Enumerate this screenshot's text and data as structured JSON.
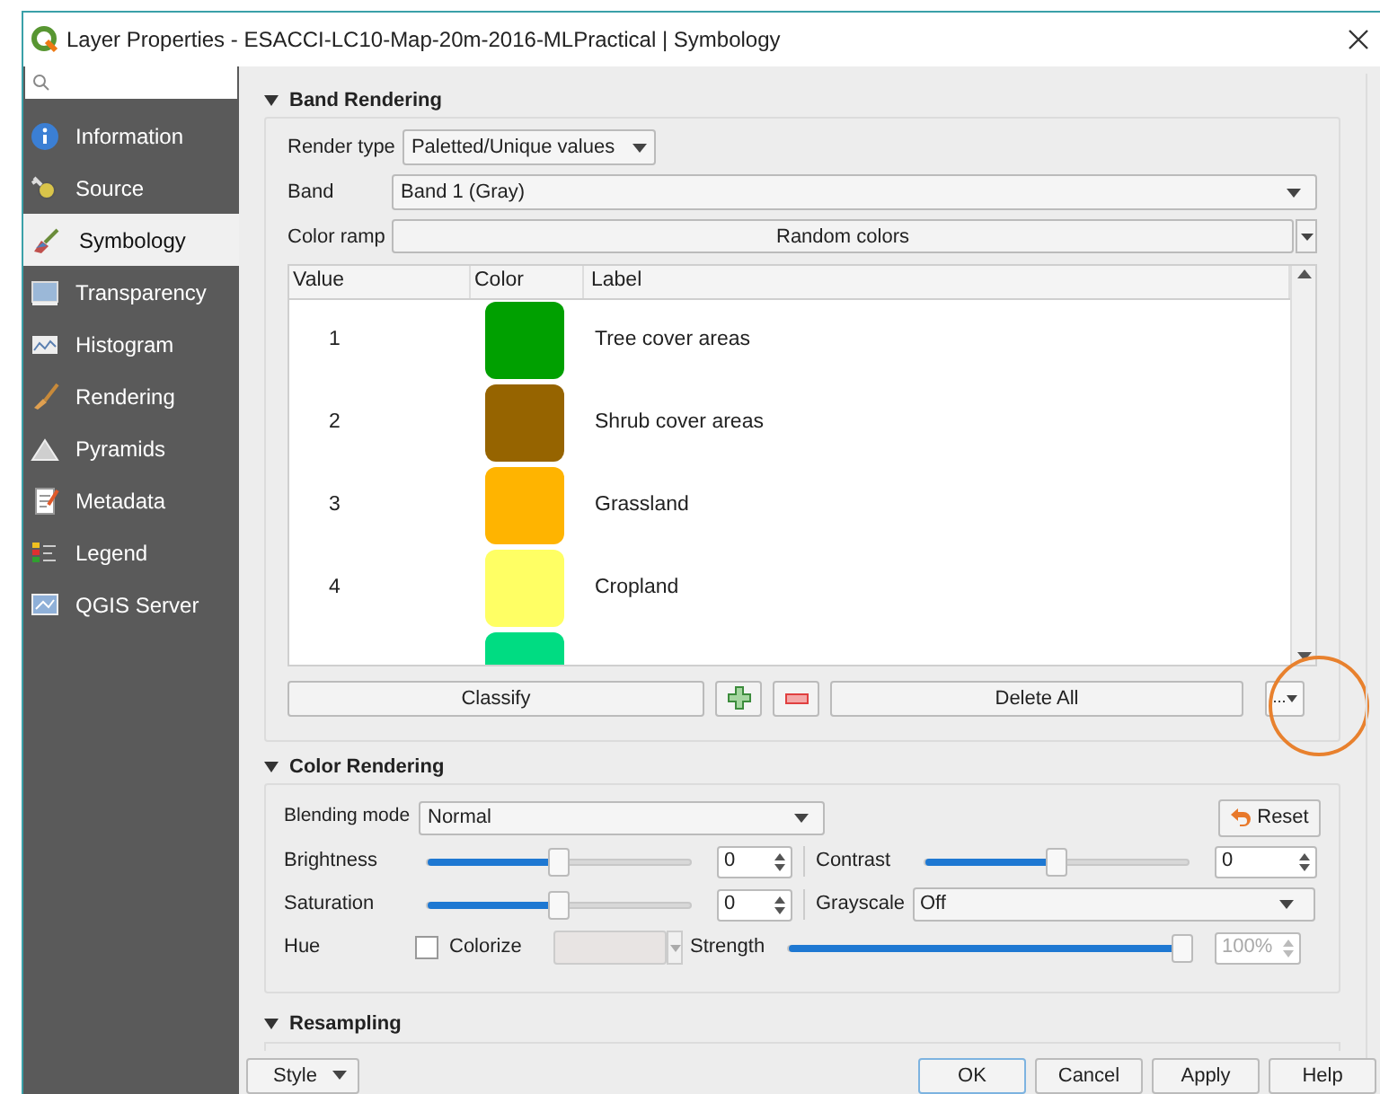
{
  "window": {
    "title": "Layer Properties - ESACCI-LC10-Map-20m-2016-MLPractical | Symbology"
  },
  "sidebar": {
    "items": [
      {
        "label": "Information",
        "selected": false
      },
      {
        "label": "Source",
        "selected": false
      },
      {
        "label": "Symbology",
        "selected": true
      },
      {
        "label": "Transparency",
        "selected": false
      },
      {
        "label": "Histogram",
        "selected": false
      },
      {
        "label": "Rendering",
        "selected": false
      },
      {
        "label": "Pyramids",
        "selected": false
      },
      {
        "label": "Metadata",
        "selected": false
      },
      {
        "label": "Legend",
        "selected": false
      },
      {
        "label": "QGIS Server",
        "selected": false
      }
    ]
  },
  "band_rendering": {
    "title": "Band Rendering",
    "render_type_label": "Render type",
    "render_type": "Paletted/Unique values",
    "band_label": "Band",
    "band": "Band 1 (Gray)",
    "color_ramp_label": "Color ramp",
    "color_ramp": "Random colors",
    "table": {
      "columns": [
        "Value",
        "Color",
        "Label"
      ],
      "rows": [
        {
          "value": "1",
          "color": "#00a000",
          "label": "Tree cover areas"
        },
        {
          "value": "2",
          "color": "#966400",
          "label": "Shrub cover areas"
        },
        {
          "value": "3",
          "color": "#ffb400",
          "label": "Grassland"
        },
        {
          "value": "4",
          "color": "#ffff64",
          "label": "Cropland"
        },
        {
          "color": "#00dc82"
        }
      ]
    },
    "classify": "Classify",
    "delete_all": "Delete All",
    "more": "..."
  },
  "color_rendering": {
    "title": "Color Rendering",
    "blending_label": "Blending mode",
    "blending_mode": "Normal",
    "reset": "Reset",
    "brightness": {
      "label": "Brightness",
      "level": 0.5,
      "value": "0"
    },
    "contrast": {
      "label": "Contrast",
      "level": 0.5,
      "value": "0"
    },
    "saturation": {
      "label": "Saturation",
      "level": 0.5,
      "value": "0"
    },
    "grayscale": {
      "label": "Grayscale",
      "value": "Off"
    },
    "hue": {
      "label": "Hue",
      "colorize_label": "Colorize",
      "colorize": false,
      "strength_label": "Strength",
      "strength": {
        "level": 1,
        "value": "100%",
        "disabled": true
      }
    }
  },
  "resampling": {
    "title": "Resampling"
  },
  "footer": {
    "style": "Style",
    "buttons": [
      "OK",
      "Cancel",
      "Apply",
      "Help"
    ]
  }
}
